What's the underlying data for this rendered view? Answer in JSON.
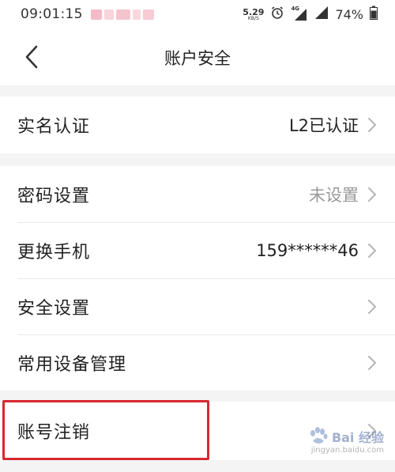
{
  "status_bar": {
    "time": "09:01:15",
    "net_speed": "5.29",
    "net_speed_unit": "KB/S",
    "signal_label": "4G",
    "battery": "74%"
  },
  "header": {
    "title": "账户安全"
  },
  "rows": [
    {
      "label": "实名认证",
      "value": "L2已认证"
    },
    {
      "label": "密码设置",
      "value": "未设置"
    },
    {
      "label": "更换手机",
      "value": "159******46"
    },
    {
      "label": "安全设置",
      "value": ""
    },
    {
      "label": "常用设备管理",
      "value": ""
    },
    {
      "label": "账号注销",
      "value": ""
    }
  ],
  "watermark": {
    "text": "Bai 经验",
    "url": "jingyan.baidu.com"
  },
  "colors": {
    "highlight": "#d8282f",
    "muted": "#999999",
    "section_gap": "#f4f4f4"
  }
}
